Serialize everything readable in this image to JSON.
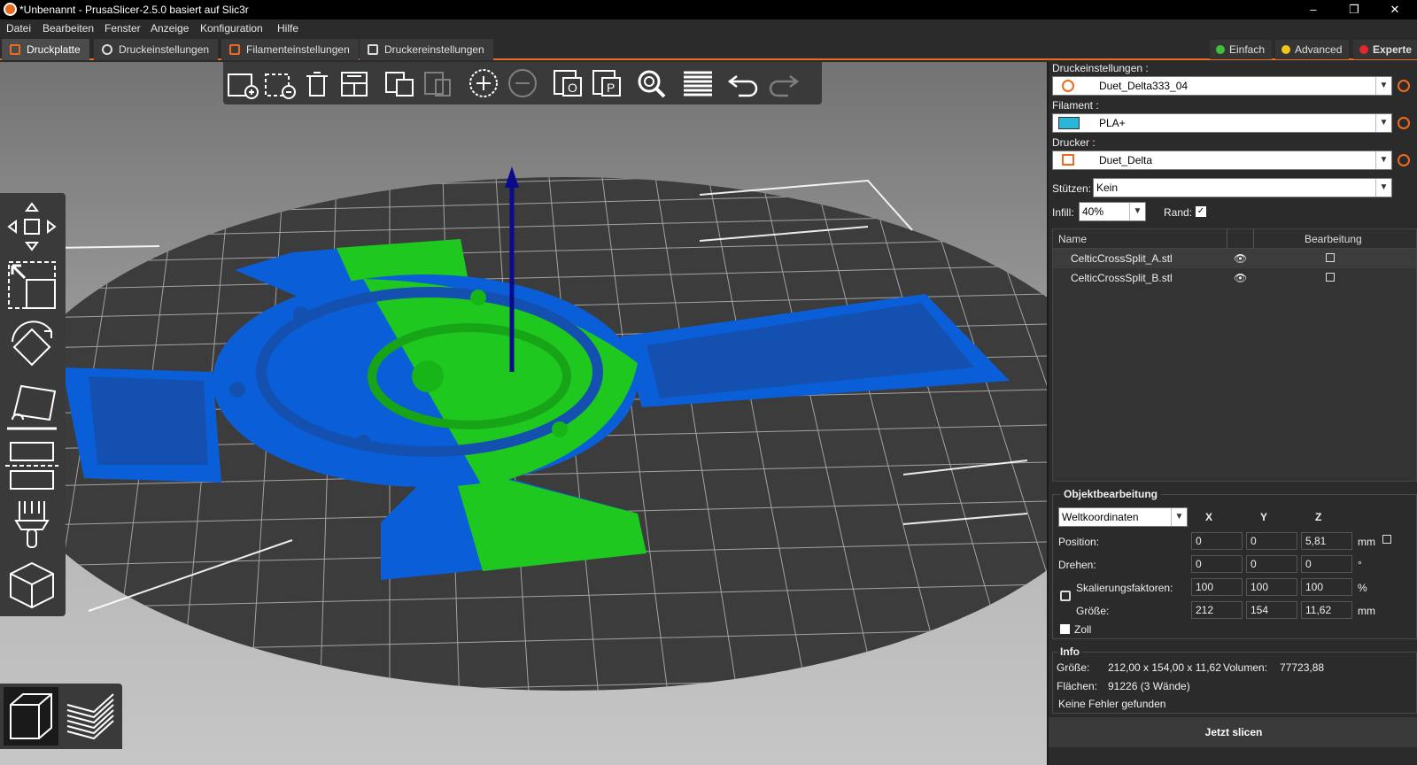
{
  "titlebar": {
    "title": "*Unbenannt - PrusaSlicer-2.5.0 basiert auf Slic3r",
    "minimize": "–",
    "restore": "❐",
    "close": "✕"
  },
  "menu": [
    "Datei",
    "Bearbeiten",
    "Fenster",
    "Anzeige",
    "Konfiguration",
    "Hilfe"
  ],
  "tabs": [
    "Druckplatte",
    "Druckeinstellungen",
    "Filamenteinstellungen",
    "Druckereinstellungen"
  ],
  "modes": {
    "simple": "Einfach",
    "advanced": "Advanced",
    "expert": "Experte",
    "colors": {
      "simple": "#3ec23a",
      "advanced": "#f0c419",
      "expert": "#e22929"
    }
  },
  "sidebar": {
    "print_label": "Druckeinstellungen :",
    "print_value": "Duet_Delta333_04",
    "filament_label": "Filament :",
    "filament_value": "PLA+",
    "printer_label": "Drucker :",
    "printer_value": "Duet_Delta",
    "supports_label": "Stützen:",
    "supports_value": "Kein",
    "infill_label": "Infill:",
    "infill_value": "40%",
    "brim_label": "Rand:",
    "brim_checked": true
  },
  "objects": {
    "col_name": "Name",
    "col_edit": "Bearbeitung",
    "rows": [
      {
        "name": "CelticCrossSplit_A.stl"
      },
      {
        "name": "CelticCrossSplit_B.stl"
      }
    ]
  },
  "manipulation": {
    "title": "Objektbearbeitung",
    "coord_system": "Weltkoordinaten",
    "axes": [
      "X",
      "Y",
      "Z"
    ],
    "position_label": "Position:",
    "position": [
      "0",
      "0",
      "5,81"
    ],
    "position_unit": "mm",
    "rotation_label": "Drehen:",
    "rotation": [
      "0",
      "0",
      "0"
    ],
    "rotation_unit": "°",
    "scale_label": "Skalierungsfaktoren:",
    "scale": [
      "100",
      "100",
      "100"
    ],
    "scale_unit": "%",
    "size_label": "Größe:",
    "size": [
      "212",
      "154",
      "11,62"
    ],
    "size_unit": "mm",
    "inches_label": "Zoll"
  },
  "info": {
    "title": "Info",
    "size_label": "Größe:",
    "size_value": "212,00 x 154,00 x 11,62",
    "volume_label": "Volumen:",
    "volume_value": "77723,88",
    "facets_label": "Flächen:",
    "facets_value": "91226 (3 Wände)",
    "errors": "Keine Fehler gefunden"
  },
  "slice_button": "Jetzt slicen",
  "colors": {
    "accent": "#ed6b21",
    "part_a": "#0a5fd8",
    "part_b": "#1fc81f",
    "bed": "#3c3c3c"
  }
}
